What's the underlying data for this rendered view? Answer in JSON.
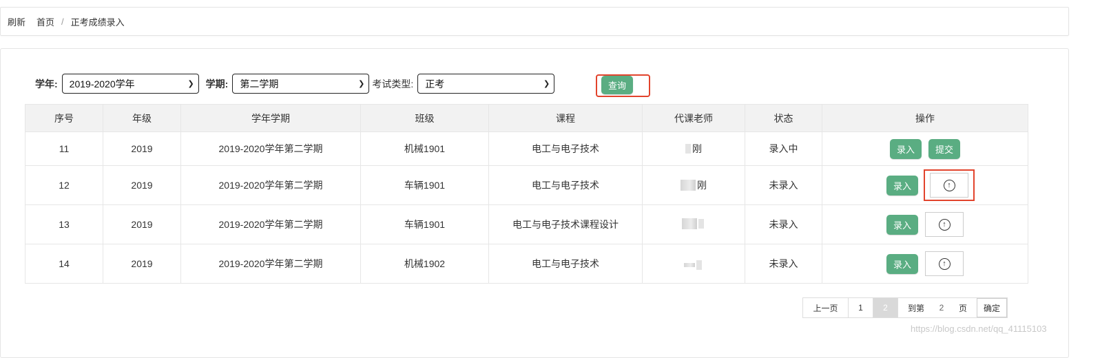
{
  "breadcrumb": {
    "refresh": "刷新",
    "home": "首页",
    "separator": "/",
    "current": "正考成绩录入"
  },
  "filters": {
    "year_label": "学年:",
    "year_value": "2019-2020学年",
    "term_label": "学期:",
    "term_value": "第二学期",
    "exam_label": "考试类型:",
    "exam_value": "正考",
    "query_button": "查询"
  },
  "table": {
    "headers": [
      "序号",
      "年级",
      "学年学期",
      "班级",
      "课程",
      "代课老师",
      "状态",
      "操作"
    ],
    "rows": [
      {
        "no": "11",
        "grade": "2019",
        "term": "2019-2020学年第二学期",
        "class": "机械1901",
        "course": "电工与电子技术",
        "teacher": "刚",
        "status": "录入中"
      },
      {
        "no": "12",
        "grade": "2019",
        "term": "2019-2020学年第二学期",
        "class": "车辆1901",
        "course": "电工与电子技术",
        "teacher": "刚",
        "status": "未录入"
      },
      {
        "no": "13",
        "grade": "2019",
        "term": "2019-2020学年第二学期",
        "class": "车辆1901",
        "course": "电工与电子技术课程设计",
        "teacher": "",
        "status": "未录入"
      },
      {
        "no": "14",
        "grade": "2019",
        "term": "2019-2020学年第二学期",
        "class": "机械1902",
        "course": "电工与电子技术",
        "teacher": "",
        "status": "未录入"
      }
    ],
    "enter_button": "录入",
    "submit_button": "提交"
  },
  "pager": {
    "prev": "上一页",
    "page1": "1",
    "page2": "2",
    "goto": "到第",
    "goto_value": "2",
    "page_word": "页",
    "confirm": "确定"
  },
  "watermark": "https://blog.csdn.net/qq_41115103",
  "colors": {
    "accent_green": "#5aad82",
    "highlight_red": "#e2432c"
  }
}
